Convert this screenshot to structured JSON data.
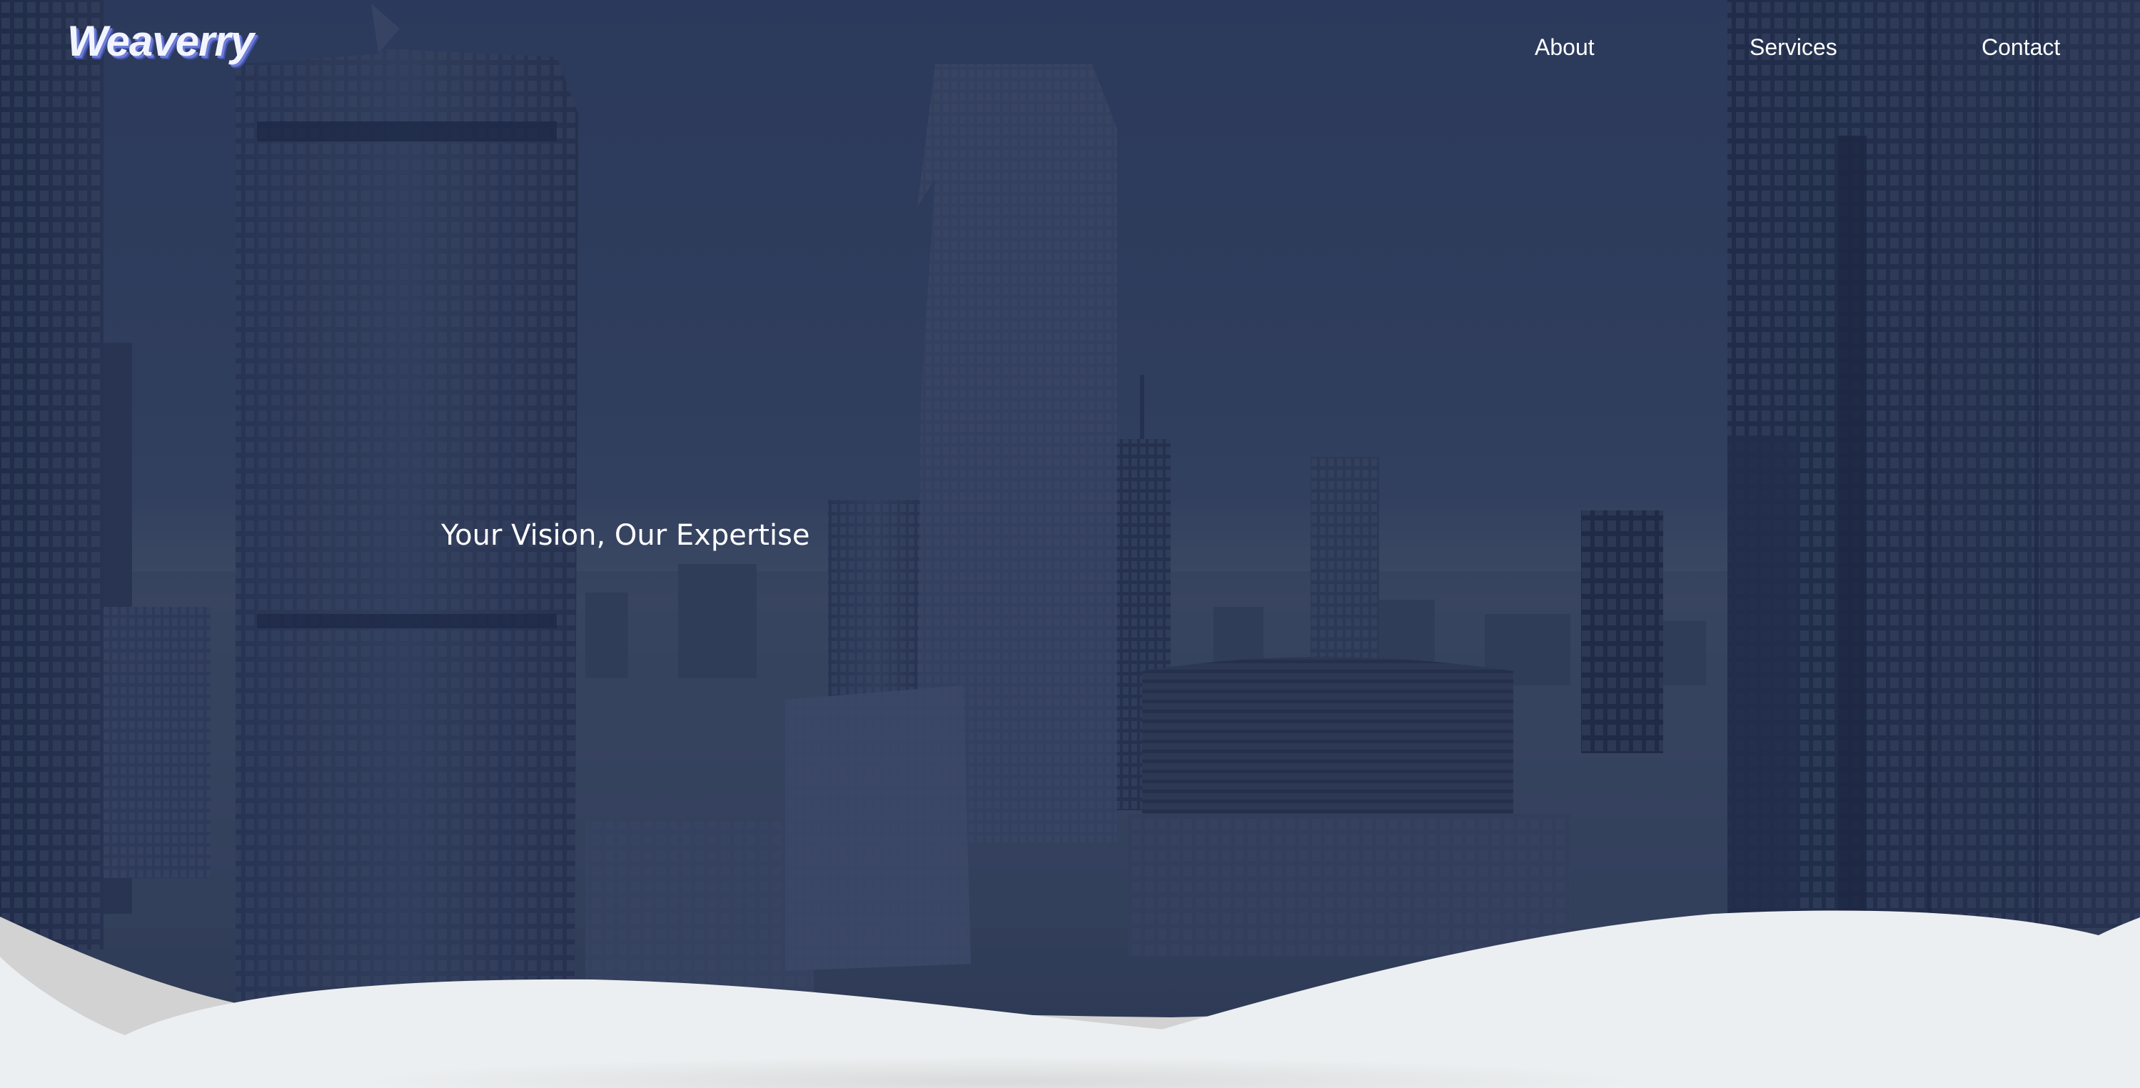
{
  "brand": {
    "name": "Weaverry"
  },
  "nav": {
    "items": [
      {
        "label": "About"
      },
      {
        "label": "Services"
      },
      {
        "label": "Contact"
      }
    ]
  },
  "hero": {
    "tagline": "Your Vision, Our Expertise"
  },
  "colors": {
    "overlay": "#2f3d5e",
    "wave_light": "#eceff1",
    "wave_grey": "#d4d4d4",
    "logo_shadow": "#6d7dd8",
    "text": "#ffffff"
  }
}
